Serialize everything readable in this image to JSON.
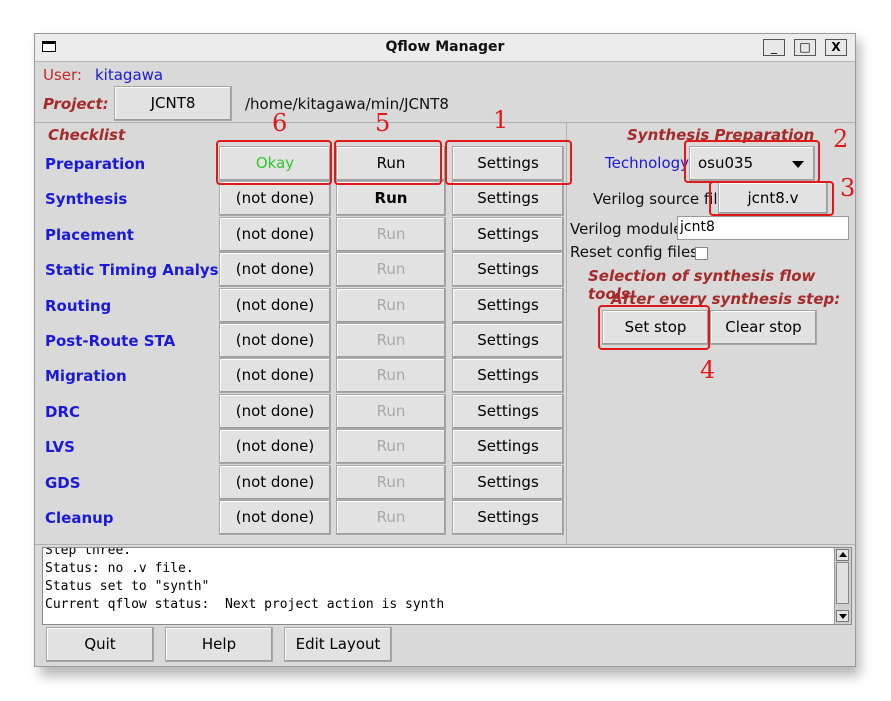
{
  "window": {
    "title": "Qflow Manager",
    "btn_min": "_",
    "btn_max": "□",
    "btn_close": "X"
  },
  "user": {
    "label": "User:",
    "value": "kitagawa"
  },
  "project": {
    "label": "Project:",
    "button": "JCNT8",
    "path": "/home/kitagawa/min/JCNT8"
  },
  "checklist": {
    "header": "Checklist",
    "rows": [
      {
        "name": "Preparation",
        "status": "Okay",
        "run": "Run",
        "settings": "Settings"
      },
      {
        "name": "Synthesis",
        "status": "(not done)",
        "run": "Run",
        "settings": "Settings"
      },
      {
        "name": "Placement",
        "status": "(not done)",
        "run": "Run",
        "settings": "Settings"
      },
      {
        "name": "Static Timing Analysis",
        "status": "(not done)",
        "run": "Run",
        "settings": "Settings"
      },
      {
        "name": "Routing",
        "status": "(not done)",
        "run": "Run",
        "settings": "Settings"
      },
      {
        "name": "Post-Route STA",
        "status": "(not done)",
        "run": "Run",
        "settings": "Settings"
      },
      {
        "name": "Migration",
        "status": "(not done)",
        "run": "Run",
        "settings": "Settings"
      },
      {
        "name": "DRC",
        "status": "(not done)",
        "run": "Run",
        "settings": "Settings"
      },
      {
        "name": "LVS",
        "status": "(not done)",
        "run": "Run",
        "settings": "Settings"
      },
      {
        "name": "GDS",
        "status": "(not done)",
        "run": "Run",
        "settings": "Settings"
      },
      {
        "name": "Cleanup",
        "status": "(not done)",
        "run": "Run",
        "settings": "Settings"
      }
    ]
  },
  "synth_prep": {
    "header": "Synthesis Preparation",
    "technology_label": "Technology:",
    "technology_value": "osu035",
    "verilog_source_label": "Verilog source file:",
    "verilog_source_value": "jcnt8.v",
    "verilog_module_label": "Verilog module:",
    "verilog_module_value": "jcnt8",
    "reset_config_label": "Reset config files:",
    "flow_tools_heading": "Selection of synthesis flow tools:",
    "after_step_heading": "After every synthesis step:",
    "set_stop": "Set stop",
    "clear_stop": "Clear stop"
  },
  "console": {
    "lines": [
      "Step three.",
      "Status: no .v file.",
      "Status set to \"synth\"",
      "Current qflow status:  Next project action is synth"
    ]
  },
  "bottom": {
    "quit": "Quit",
    "help": "Help",
    "edit_layout": "Edit Layout"
  },
  "annotations": {
    "n1": "1",
    "n2": "2",
    "n3": "3",
    "n4": "4",
    "n5": "5",
    "n6": "6"
  },
  "colors": {
    "annotation_red": "#e01818",
    "okay_green": "#2fc72f",
    "label_blue": "#1a1ad8",
    "heading_red": "#a52a2a"
  }
}
